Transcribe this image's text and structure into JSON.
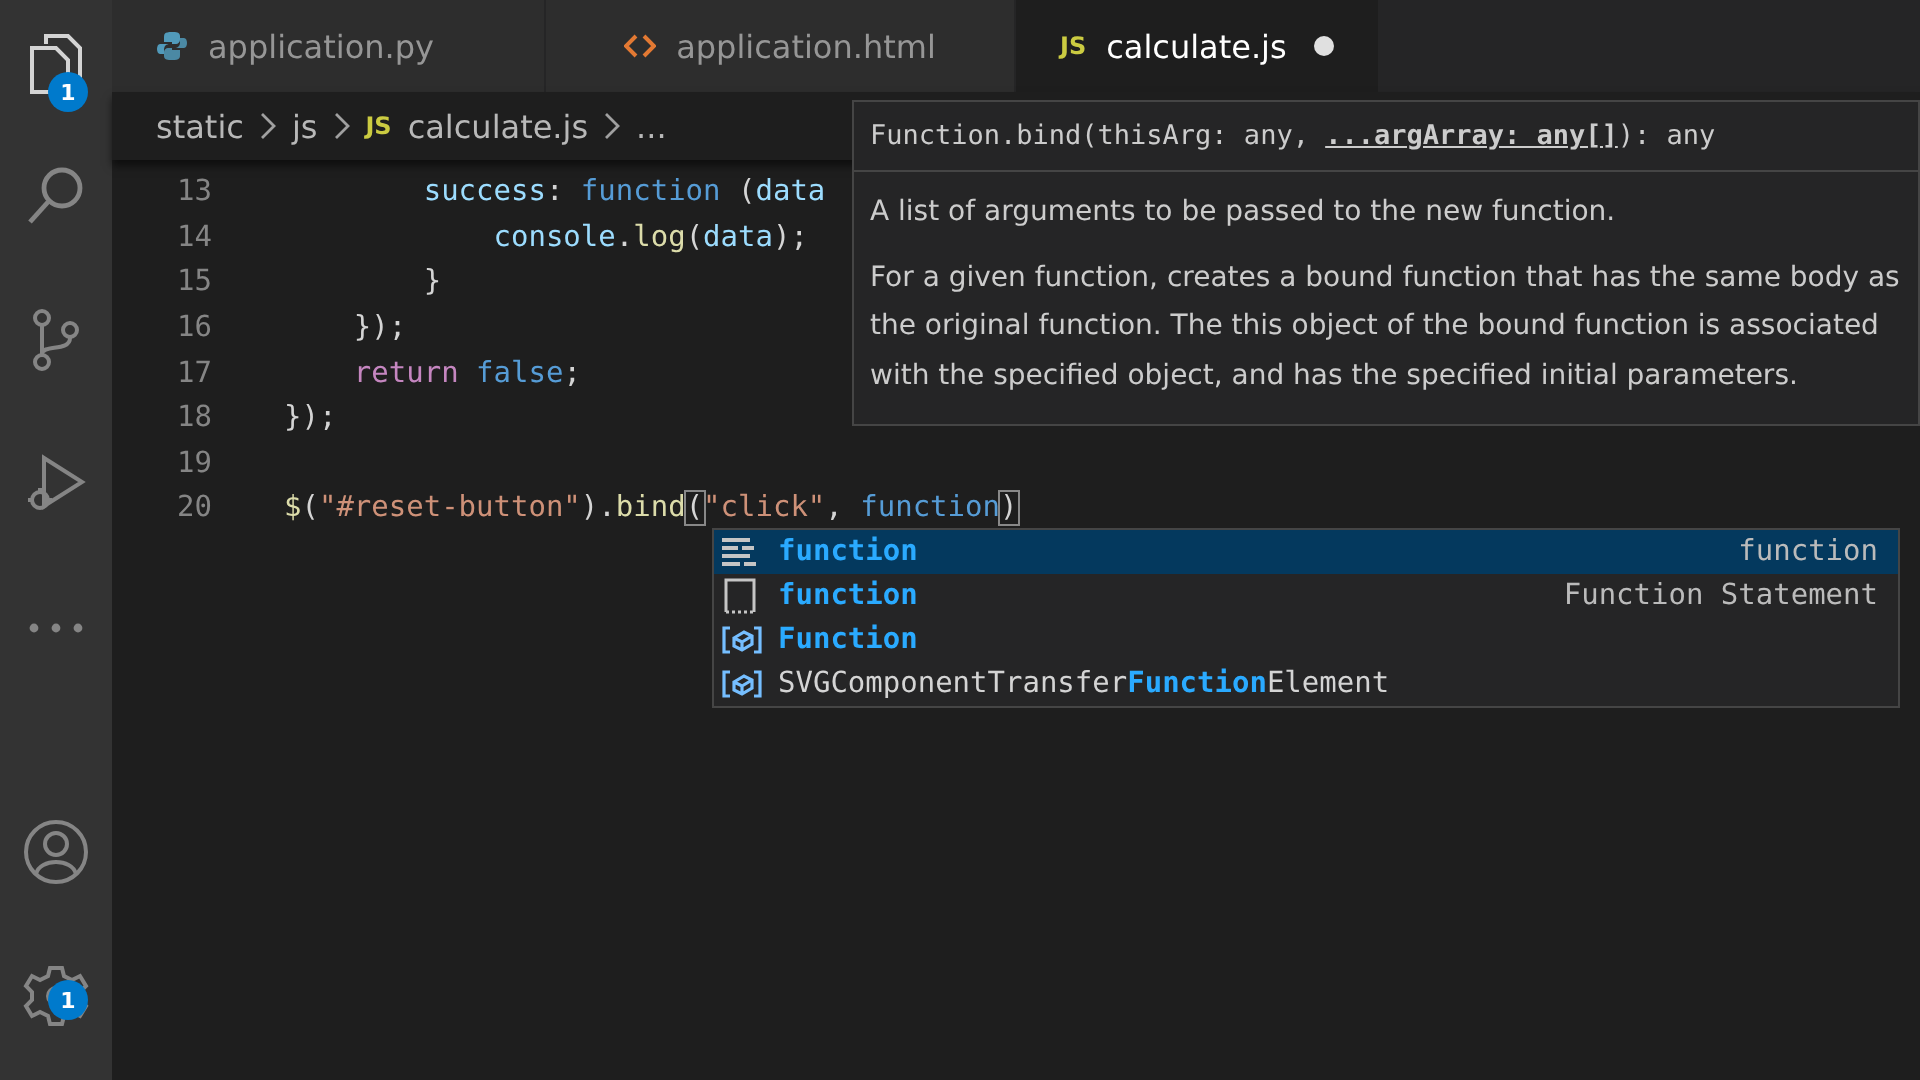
{
  "activity_bar": {
    "items": [
      {
        "kind": "files",
        "badge": "1",
        "selected": true
      },
      {
        "kind": "search",
        "selected": false
      },
      {
        "kind": "source-control",
        "selected": false
      },
      {
        "kind": "run",
        "selected": false
      },
      {
        "kind": "more",
        "selected": false
      }
    ],
    "bottom_items": [
      {
        "kind": "account"
      },
      {
        "kind": "settings",
        "badge": "1"
      }
    ]
  },
  "tabs": [
    {
      "label": "application.py",
      "kind": "python",
      "selected": false,
      "modified": false
    },
    {
      "label": "application.html",
      "kind": "html",
      "selected": false,
      "modified": false
    },
    {
      "label": "calculate.js",
      "kind": "js",
      "icon_text": "JS",
      "selected": true,
      "modified": true
    }
  ],
  "breadcrumb": [
    {
      "label": "static"
    },
    {
      "label": "js"
    },
    {
      "label": "calculate.js",
      "icon_text": "JS"
    },
    {
      "label": "..."
    }
  ],
  "editor": {
    "lines": [
      {
        "number": "13",
        "tokens": [
          {
            "text": "        success",
            "kind": "prop"
          },
          {
            "text": ": ",
            "kind": "punct"
          },
          {
            "text": "function",
            "kind": "keyword"
          },
          {
            "text": " (",
            "kind": "punct"
          },
          {
            "text": "data",
            "kind": "prop"
          }
        ]
      },
      {
        "number": "14",
        "tokens": [
          {
            "text": "            console",
            "kind": "prop"
          },
          {
            "text": ".",
            "kind": "punct"
          },
          {
            "text": "log",
            "kind": "func"
          },
          {
            "text": "(",
            "kind": "punct"
          },
          {
            "text": "data",
            "kind": "prop"
          },
          {
            "text": ");",
            "kind": "punct"
          }
        ]
      },
      {
        "number": "15",
        "tokens": [
          {
            "text": "        }",
            "kind": "punct"
          }
        ]
      },
      {
        "number": "16",
        "tokens": [
          {
            "text": "    });",
            "kind": "punct"
          }
        ]
      },
      {
        "number": "17",
        "tokens": [
          {
            "text": "    return",
            "kind": "control"
          },
          {
            "text": " false",
            "kind": "keyword"
          },
          {
            "text": ";",
            "kind": "punct"
          }
        ]
      },
      {
        "number": "18",
        "tokens": [
          {
            "text": "});",
            "kind": "punct"
          }
        ]
      },
      {
        "number": "19"
      },
      {
        "number": "20",
        "tokens": [
          {
            "text": "$",
            "kind": "func"
          },
          {
            "text": "(",
            "kind": "punct"
          },
          {
            "text": "\"#reset-button\"",
            "kind": "string"
          },
          {
            "text": ").",
            "kind": "punct"
          },
          {
            "text": "bind",
            "kind": "func"
          },
          {
            "text": "(",
            "kind": "bracket"
          },
          {
            "text": "\"click\"",
            "kind": "string"
          },
          {
            "text": ", ",
            "kind": "punct"
          },
          {
            "text": "function",
            "kind": "keyword"
          },
          {
            "text": ")",
            "kind": "bracket"
          }
        ]
      }
    ]
  },
  "hover": {
    "signature": "Function.bind(thisArg: any, **...argArray: any[]**): any",
    "paragraphs": [
      "A list of arguments to be passed to the new function.",
      "For a given function, creates a bound function that has the same body as the original function. The this object of the bound function is associated with the specified object, and has the specified initial parameters."
    ]
  },
  "suggestions": [
    {
      "kind": "keyword",
      "parts": [
        {
          "text": "function",
          "match": true
        }
      ],
      "detail": "function",
      "selected": true
    },
    {
      "kind": "snippet",
      "parts": [
        {
          "text": "function",
          "match": true
        }
      ],
      "detail": "Function Statement",
      "selected": false
    },
    {
      "kind": "variable",
      "parts": [
        {
          "text": "Function",
          "match": true
        }
      ],
      "selected": false
    },
    {
      "kind": "variable",
      "parts": [
        {
          "text": "SVGComponentTransfer",
          "match": false
        },
        {
          "text": "Function",
          "match": true
        },
        {
          "text": "Element",
          "match": false
        }
      ],
      "selected": false
    }
  ]
}
